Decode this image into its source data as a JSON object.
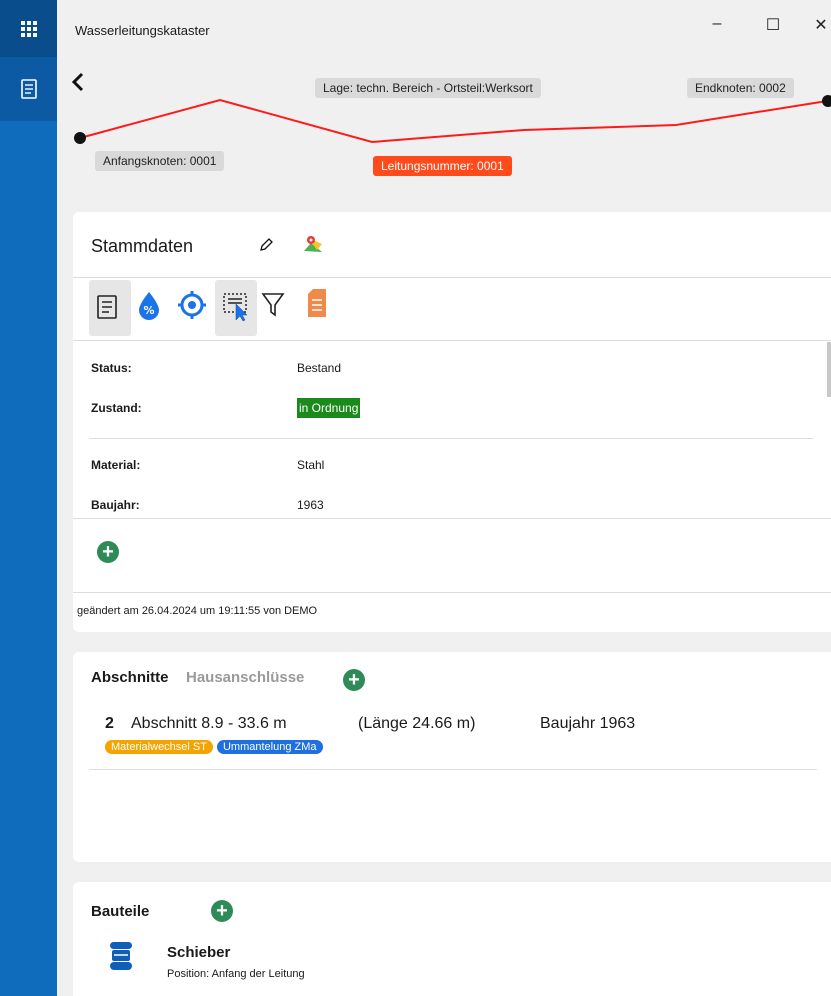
{
  "window": {
    "title": "Wasserleitungskataster",
    "minimize": "–",
    "maximize": "☐",
    "close": "✕"
  },
  "route": {
    "lage": "Lage: techn. Bereich - Ortsteil:Werksort",
    "endknoten": "Endknoten: 0002",
    "anfangsknoten": "Anfangsknoten: 0001",
    "leitungsnummer": "Leitungsnummer: 0001",
    "line_color": "#ff1a1a"
  },
  "stammdaten": {
    "title": "Stammdaten",
    "fields": [
      {
        "label": "Status:",
        "value": "Bestand"
      },
      {
        "label": "Zustand:",
        "value": "in Ordnung"
      },
      {
        "label": "Material:",
        "value": "Stahl"
      },
      {
        "label": "Baujahr:",
        "value": "1963"
      }
    ],
    "footer": "geändert am 26.04.2024 um 19:11:55 von DEMO"
  },
  "abschnitte": {
    "tab_active": "Abschnitte",
    "tab_inactive": "Hausanschlüsse",
    "rows": [
      {
        "nr": "2",
        "range": "Abschnitt 8.9 - 33.6 m",
        "laenge": "(Länge 24.66 m)",
        "baujahr": "Baujahr 1963",
        "tags": [
          {
            "text": "Materialwechsel ST",
            "color": "#f5a300"
          },
          {
            "text": "Ummantelung ZMa",
            "color": "#1e6fe0"
          }
        ]
      }
    ]
  },
  "bauteile": {
    "title": "Bauteile",
    "items": [
      {
        "name": "Schieber",
        "position": "Position: Anfang der Leitung"
      }
    ]
  },
  "colors": {
    "accent": "#0f6cbd",
    "add": "#2e8b57",
    "status_ok": "#1a8a1a"
  }
}
